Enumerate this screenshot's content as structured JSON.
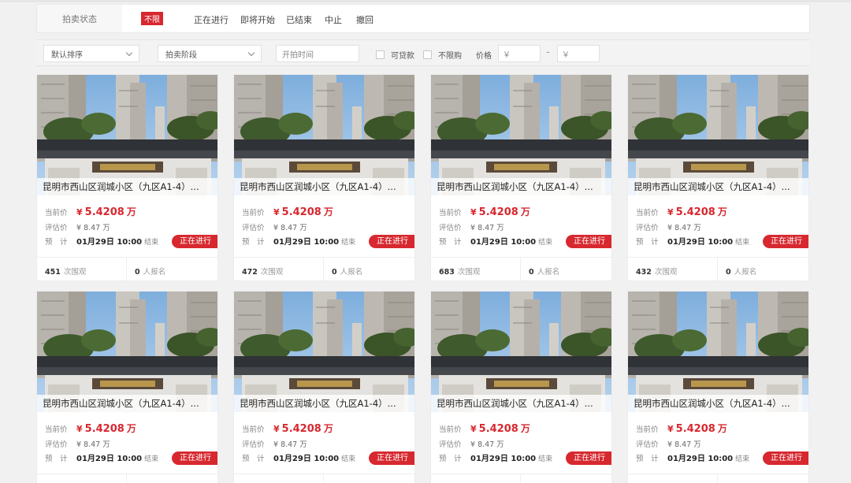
{
  "status_filter": {
    "label": "拍卖状态",
    "options": [
      "不限",
      "正在进行",
      "即将开始",
      "已结束",
      "中止",
      "撤回"
    ]
  },
  "filter_bar": {
    "sort_select": "默认排序",
    "stage_select": "拍卖阶段",
    "start_time_placeholder": "开拍时间",
    "loan_checkbox": "可贷款",
    "no_limit_checkbox": "不限购",
    "price_label": "价格",
    "price_min_placeholder": "￥",
    "price_dash": "–",
    "price_max_placeholder": "￥"
  },
  "colors": {
    "accent": "#d7282f"
  },
  "listing_labels": {
    "current_price": "当前价",
    "estimated_price": "评估价",
    "expected": "预　计",
    "end_suffix": "结束",
    "views_suffix": "次围观",
    "signups_suffix": "人报名"
  },
  "listings": [
    {
      "title": "昆明市西山区润城小区（九区A1-4）...",
      "price_symbol": "¥",
      "price": "5.4208",
      "price_unit": "万",
      "estimate": "¥ 8.47 万",
      "end_time": "01月29日 10:00",
      "status": "正在进行",
      "views": "451",
      "signups": "0"
    },
    {
      "title": "昆明市西山区润城小区（九区A1-4）...",
      "price_symbol": "¥",
      "price": "5.4208",
      "price_unit": "万",
      "estimate": "¥ 8.47 万",
      "end_time": "01月29日 10:00",
      "status": "正在进行",
      "views": "472",
      "signups": "0"
    },
    {
      "title": "昆明市西山区润城小区（九区A1-4）...",
      "price_symbol": "¥",
      "price": "5.4208",
      "price_unit": "万",
      "estimate": "¥ 8.47 万",
      "end_time": "01月29日 10:00",
      "status": "正在进行",
      "views": "683",
      "signups": "0"
    },
    {
      "title": "昆明市西山区润城小区（九区A1-4）...",
      "price_symbol": "¥",
      "price": "5.4208",
      "price_unit": "万",
      "estimate": "¥ 8.47 万",
      "end_time": "01月29日 10:00",
      "status": "正在进行",
      "views": "432",
      "signups": "0"
    },
    {
      "title": "昆明市西山区润城小区（九区A1-4）...",
      "price_symbol": "¥",
      "price": "5.4208",
      "price_unit": "万",
      "estimate": "¥ 8.47 万",
      "end_time": "01月29日 10:00",
      "status": "正在进行",
      "views": "",
      "signups": ""
    },
    {
      "title": "昆明市西山区润城小区（九区A1-4）...",
      "price_symbol": "¥",
      "price": "5.4208",
      "price_unit": "万",
      "estimate": "¥ 8.47 万",
      "end_time": "01月29日 10:00",
      "status": "正在进行",
      "views": "",
      "signups": ""
    },
    {
      "title": "昆明市西山区润城小区（九区A1-4）...",
      "price_symbol": "¥",
      "price": "5.4208",
      "price_unit": "万",
      "estimate": "¥ 8.47 万",
      "end_time": "01月29日 10:00",
      "status": "正在进行",
      "views": "",
      "signups": ""
    },
    {
      "title": "昆明市西山区润城小区（九区A1-4）...",
      "price_symbol": "¥",
      "price": "5.4208",
      "price_unit": "万",
      "estimate": "¥ 8.47 万",
      "end_time": "01月29日 10:00",
      "status": "正在进行",
      "views": "",
      "signups": ""
    }
  ]
}
